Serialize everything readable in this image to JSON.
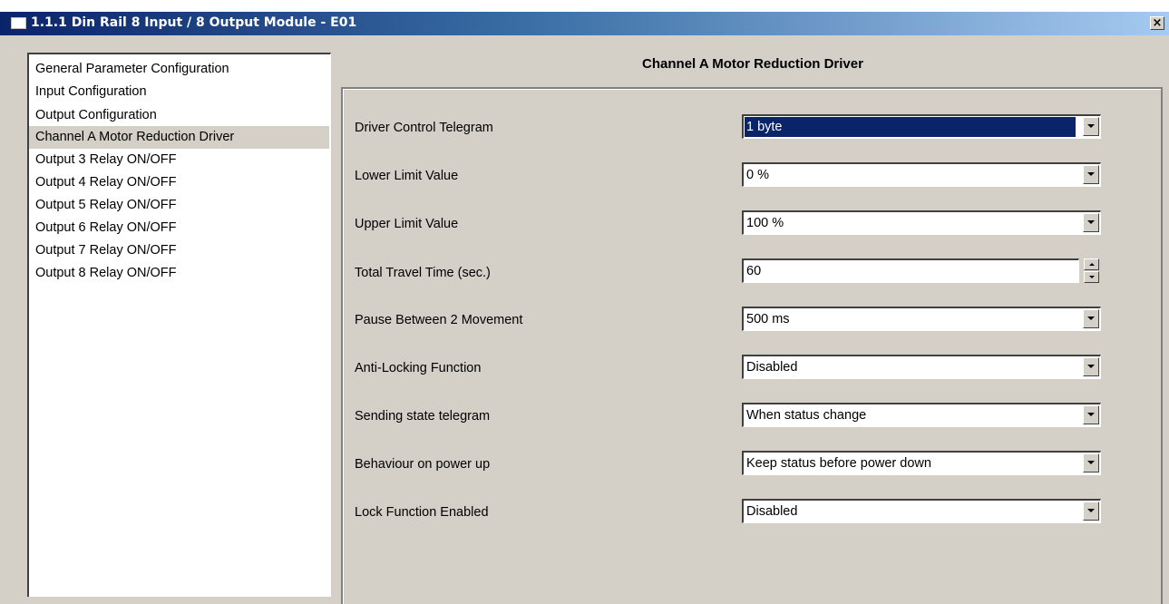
{
  "window": {
    "title": "1.1.1 Din Rail 8 Input / 8 Output Module - E01",
    "close_label": "×"
  },
  "nav": {
    "items": [
      "General Parameter Configuration",
      "Input Configuration",
      "Output Configuration",
      "Channel A Motor Reduction Driver",
      "Output 3 Relay ON/OFF",
      "Output 4 Relay ON/OFF",
      "Output 5 Relay ON/OFF",
      "Output 6 Relay ON/OFF",
      "Output 7 Relay ON/OFF",
      "Output 8 Relay ON/OFF"
    ],
    "selected": "Channel A Motor Reduction Driver"
  },
  "main": {
    "title": "Channel A Motor Reduction Driver",
    "params": [
      {
        "label": "Driver Control Telegram",
        "value": "1 byte",
        "control": "dropdown",
        "focused": true
      },
      {
        "label": "Lower Limit Value",
        "value": "0 %",
        "control": "dropdown"
      },
      {
        "label": "Upper Limit Value",
        "value": "100 %",
        "control": "dropdown"
      },
      {
        "label": "Total Travel Time (sec.)",
        "value": "60",
        "control": "spinner"
      },
      {
        "label": "Pause Between 2 Movement",
        "value": "500 ms",
        "control": "dropdown"
      },
      {
        "label": "Anti-Locking Function",
        "value": "Disabled",
        "control": "dropdown"
      },
      {
        "label": "Sending state telegram",
        "value": "When status change",
        "control": "dropdown"
      },
      {
        "label": "Behaviour on power up",
        "value": "Keep status before power down",
        "control": "dropdown"
      },
      {
        "label": "Lock Function Enabled",
        "value": "Disabled",
        "control": "dropdown"
      }
    ]
  },
  "colors": {
    "titlebar_start": "#0a246a",
    "titlebar_end": "#a6caf0",
    "selection": "#0a246a",
    "face": "#d4d0c8"
  }
}
